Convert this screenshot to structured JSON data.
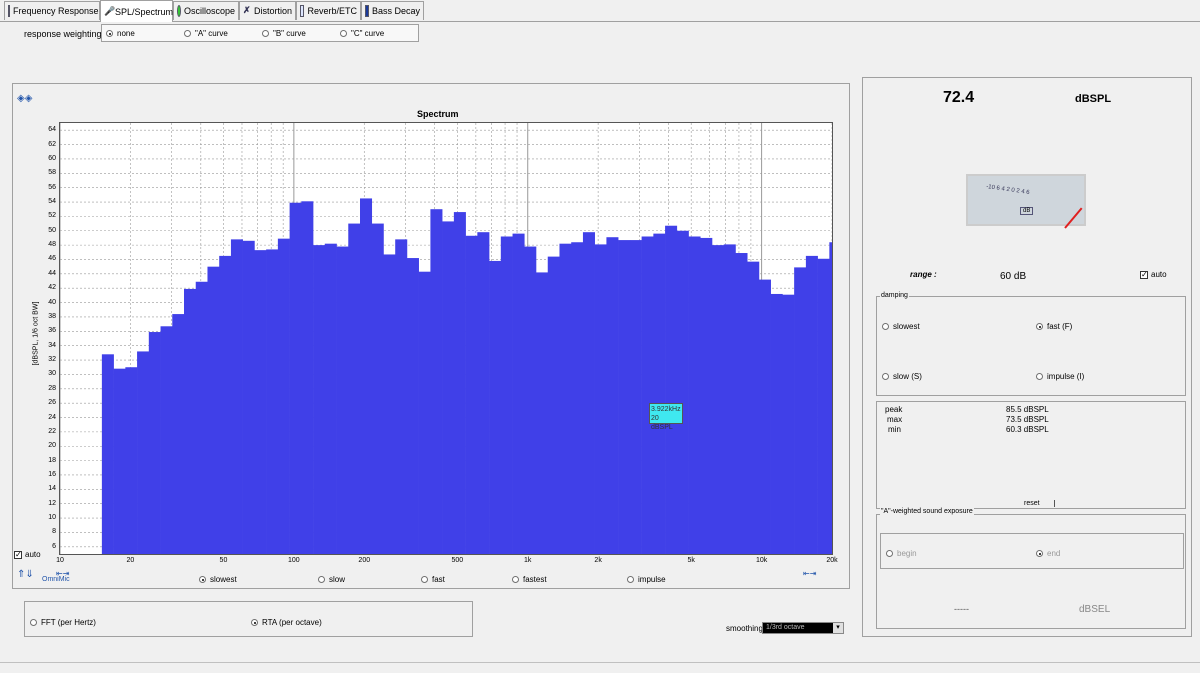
{
  "tabs": [
    {
      "label": "Frequency Response",
      "active": false
    },
    {
      "label": "SPL/Spectrum",
      "active": true
    },
    {
      "label": "Oscilloscope",
      "active": false
    },
    {
      "label": "Distortion",
      "active": false
    },
    {
      "label": "Reverb/ETC",
      "active": false
    },
    {
      "label": "Bass Decay",
      "active": false
    }
  ],
  "weighting": {
    "label": "response weighting",
    "options": [
      "none",
      "\"A\" curve",
      "\"B\" curve",
      "\"C\" curve"
    ],
    "selected": "none"
  },
  "chart_data": {
    "type": "bar",
    "title": "Spectrum",
    "ylabel": "[dBSPL, 1/6 oct BW]",
    "xlabel": "",
    "x_scale": "log",
    "xlim": [
      10,
      20000
    ],
    "ylim": [
      5,
      65
    ],
    "yticks": [
      6,
      8,
      10,
      12,
      14,
      16,
      18,
      20,
      22,
      24,
      26,
      28,
      30,
      32,
      34,
      36,
      38,
      40,
      42,
      44,
      46,
      48,
      50,
      52,
      54,
      56,
      58,
      60,
      62,
      64
    ],
    "xtick_labels": [
      {
        "value": 10,
        "label": "10"
      },
      {
        "value": 20,
        "label": "20"
      },
      {
        "value": 50,
        "label": "50"
      },
      {
        "value": 100,
        "label": "100"
      },
      {
        "value": 200,
        "label": "200"
      },
      {
        "value": 500,
        "label": "500"
      },
      {
        "value": 1000,
        "label": "1k"
      },
      {
        "value": 2000,
        "label": "2k"
      },
      {
        "value": 5000,
        "label": "5k"
      },
      {
        "value": 10000,
        "label": "10k"
      },
      {
        "value": 20000,
        "label": "20k"
      }
    ],
    "values": [
      32.8,
      30.8,
      31.0,
      33.2,
      35.9,
      36.7,
      38.4,
      41.9,
      42.9,
      45.0,
      46.5,
      48.8,
      48.6,
      47.3,
      47.4,
      48.9,
      53.9,
      54.1,
      48.0,
      48.2,
      47.8,
      51.0,
      54.5,
      51.0,
      46.7,
      48.8,
      46.2,
      44.3,
      53.0,
      51.3,
      52.6,
      49.3,
      49.8,
      45.8,
      49.2,
      49.6,
      47.8,
      44.2,
      46.4,
      48.2,
      48.4,
      49.8,
      48.1,
      49.1,
      48.7,
      48.7,
      49.2,
      49.6,
      50.7,
      50.0,
      49.2,
      49.0,
      48.0,
      48.1,
      46.9,
      45.7,
      43.2,
      41.2,
      41.1,
      44.9,
      46.5,
      46.1,
      48.4,
      45.0
    ],
    "series_color": "#4040e8",
    "grid": true
  },
  "plot_controls": {
    "auto_label": "auto",
    "omnimic_label": "OmniMic",
    "tooltip_freq": "3.922kHz",
    "tooltip_level": "20 dBSPL"
  },
  "response_speed": {
    "options": [
      "slowest",
      "slow",
      "fast",
      "fastest",
      "impulse"
    ],
    "selected": "slowest"
  },
  "analysis_mode": {
    "options": [
      "FFT (per Hertz)",
      "RTA (per octave)"
    ],
    "selected": "RTA (per octave)"
  },
  "smoothing": {
    "label": "smoothing",
    "value": "1/3rd octave"
  },
  "readout": {
    "value": "72.4",
    "unit": "dBSPL"
  },
  "meter": {
    "scale": "-10 6 4 2 0 2 4 6",
    "unit": "dB"
  },
  "range": {
    "label": "range :",
    "value": "60 dB",
    "auto_label": "auto"
  },
  "damping": {
    "title": "damping",
    "options": [
      "slowest",
      "fast (F)",
      "slow (S)",
      "impulse (I)"
    ],
    "selected": "fast (F)"
  },
  "stats": {
    "peak_label": "peak",
    "peak_value": "85.5 dBSPL",
    "max_label": "max",
    "max_value": "73.5 dBSPL",
    "min_label": "min",
    "min_value": "60.3 dBSPL",
    "reset_label": "reset"
  },
  "exposure": {
    "title": "\"A\"-weighted sound exposure",
    "begin_label": "begin",
    "end_label": "end",
    "value": "-----",
    "unit": "dBSEL"
  }
}
